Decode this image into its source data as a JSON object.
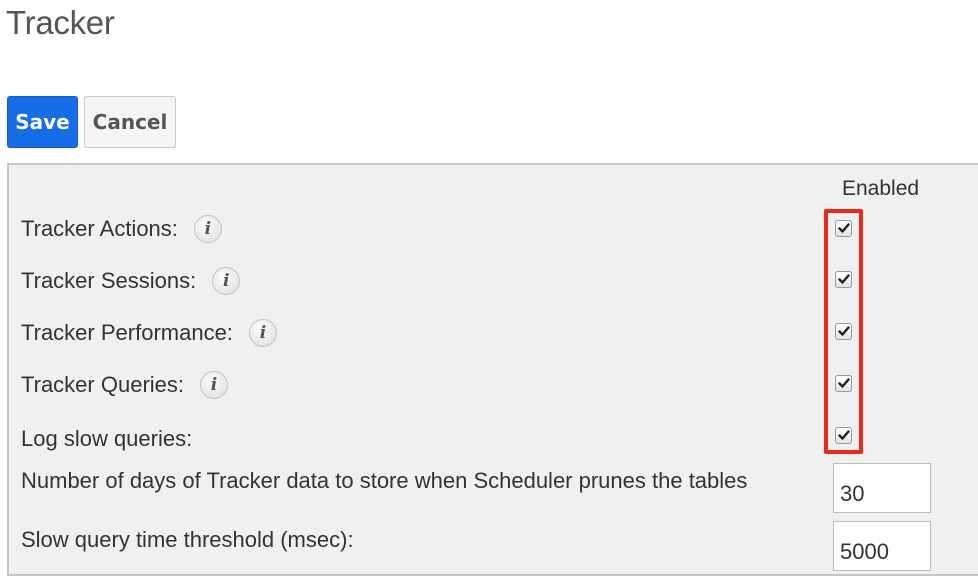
{
  "page": {
    "title": "Tracker"
  },
  "toolbar": {
    "save_label": "Save",
    "cancel_label": "Cancel"
  },
  "settings": {
    "column_header": "Enabled",
    "rows": [
      {
        "label": "Tracker Actions:",
        "has_info": true,
        "checked": true
      },
      {
        "label": "Tracker Sessions:",
        "has_info": true,
        "checked": true
      },
      {
        "label": "Tracker Performance:",
        "has_info": true,
        "checked": true
      },
      {
        "label": "Tracker Queries:",
        "has_info": true,
        "checked": true
      },
      {
        "label": "Log slow queries:",
        "has_info": false,
        "checked": true
      }
    ],
    "fields": [
      {
        "label": "Number of days of Tracker data to store when Scheduler prunes the tables",
        "value": "30"
      },
      {
        "label": "Slow query time threshold (msec):",
        "value": "5000"
      }
    ],
    "info_glyph": "i"
  },
  "colors": {
    "primary": "#176de5",
    "highlight": "#ee2a1b",
    "panel_bg": "#f0f0f0"
  },
  "icons": {
    "info": "info-icon",
    "check": "checkmark-icon"
  }
}
